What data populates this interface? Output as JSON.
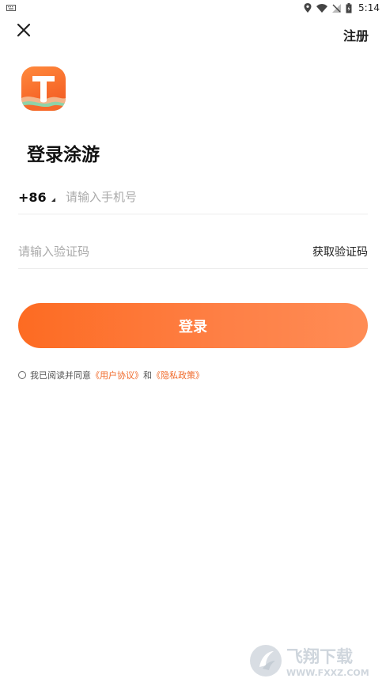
{
  "status_bar": {
    "time": "5:14",
    "icons": [
      "keyboard-icon",
      "location-icon",
      "wifi-icon",
      "no-signal-icon",
      "battery-icon"
    ]
  },
  "nav": {
    "close_icon": "close-icon",
    "register_label": "注册"
  },
  "brand": {
    "logo_letter": "T",
    "title": "登录涂游"
  },
  "phone": {
    "country_code": "+86",
    "placeholder": "请输入手机号",
    "value": ""
  },
  "code": {
    "placeholder": "请输入验证码",
    "value": "",
    "get_code_label": "获取验证码"
  },
  "login_button_label": "登录",
  "agreement": {
    "prefix": "我已阅读并同意",
    "user_agreement": "《用户协议》",
    "and": "和",
    "privacy_policy": "《隐私政策》",
    "checked": false
  },
  "watermark": {
    "text_cn": "飞翔下载",
    "text_en": "WWW.FXXZ.COM"
  },
  "colors": {
    "accent": "#f06a2a",
    "button_start": "#fd6b22",
    "button_end": "#ff8c55"
  }
}
